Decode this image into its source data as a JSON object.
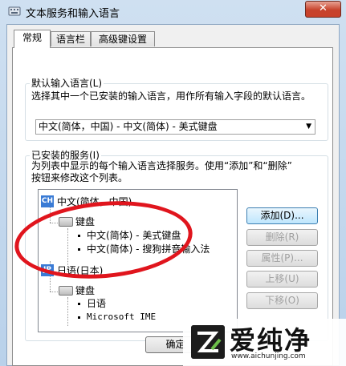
{
  "window": {
    "title": "文本服务和输入语言",
    "close_label": "✕"
  },
  "tabs": [
    "常规",
    "语言栏",
    "高级键设置"
  ],
  "default_language": {
    "label": "默认输入语言(L)",
    "description": "选择其中一个已安装的输入语言，用作所有输入字段的默认语言。",
    "selected": "中文(简体，中国) - 中文(简体) - 美式键盘"
  },
  "installed_services": {
    "label": "已安装的服务(I)",
    "description_line1": "为列表中显示的每个输入语言选择服务。使用“添加”和“删除”",
    "description_line2": "按钮来修改这个列表。",
    "tree": [
      {
        "badge": "CH",
        "language": "中文(简体，中国)",
        "group": "键盘",
        "items": [
          "中文(简体) - 美式键盘",
          "中文(简体) - 搜狗拼音输入法"
        ]
      },
      {
        "badge": "JP",
        "language": "日语(日本)",
        "group": "键盘",
        "items": [
          "日语",
          "Microsoft IME"
        ]
      }
    ]
  },
  "buttons": {
    "add": "添加(D)...",
    "remove": "删除(R)",
    "properties": "属性(P)...",
    "move_up": "上移(U)",
    "move_down": "下移(O)",
    "ok": "确定"
  },
  "watermark": {
    "brand": "爱纯净",
    "url": "www.aichunjing.com"
  },
  "colors": {
    "annotation_circle": "#e0151d",
    "selected_badge": "#3a7bd5"
  }
}
